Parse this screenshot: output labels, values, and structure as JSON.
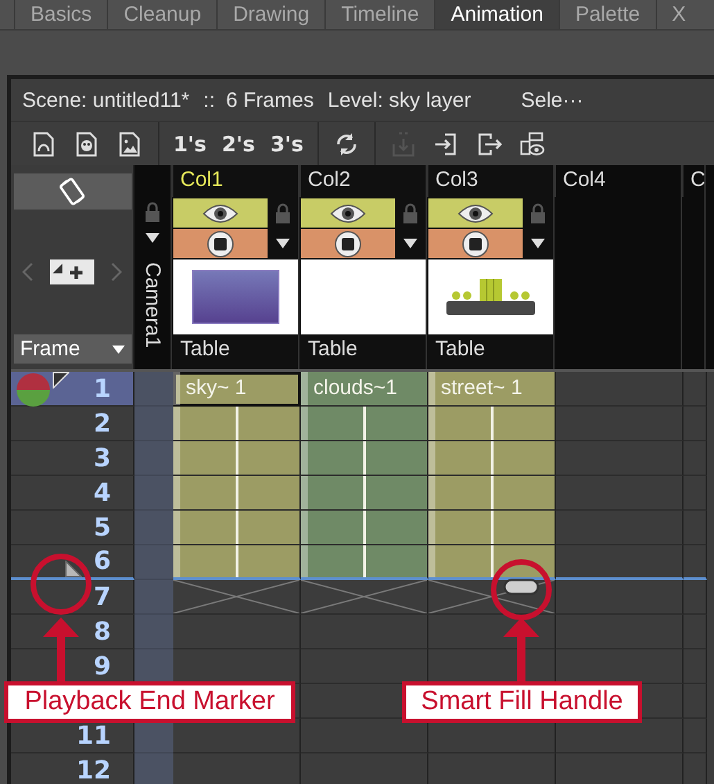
{
  "tabs": [
    {
      "label": "Basics",
      "selected": false
    },
    {
      "label": "Cleanup",
      "selected": false
    },
    {
      "label": "Drawing",
      "selected": false
    },
    {
      "label": "Timeline",
      "selected": false
    },
    {
      "label": "Animation",
      "selected": true
    },
    {
      "label": "Palette",
      "selected": false
    },
    {
      "label": "X",
      "selected": false
    }
  ],
  "scene_info": {
    "scene": "Scene: untitled11*",
    "separator": "::",
    "frames": "6 Frames",
    "level": "Level: sky layer",
    "selection": "Sele···"
  },
  "toolbar": [
    {
      "kind": "vector",
      "disabled": false
    },
    {
      "kind": "toonzraster",
      "disabled": false
    },
    {
      "kind": "raster",
      "disabled": false
    },
    {
      "kind": "step",
      "label": "1's",
      "disabled": false
    },
    {
      "kind": "step",
      "label": "2's",
      "disabled": false
    },
    {
      "kind": "step",
      "label": "3's",
      "disabled": false
    },
    {
      "kind": "cycle",
      "disabled": false
    },
    {
      "kind": "paste",
      "disabled": true
    },
    {
      "kind": "import",
      "disabled": false
    },
    {
      "kind": "export",
      "disabled": false
    },
    {
      "kind": "preview",
      "disabled": false
    }
  ],
  "frame_zoom": {
    "value": "Frame"
  },
  "camera_column": {
    "label": "Camera1",
    "locked": false
  },
  "columns": [
    {
      "name": "Col1",
      "current": true,
      "empty": false,
      "preview_visible": true,
      "camstand_visible": true,
      "locked": false,
      "thumbnail": {
        "kind": "rectangle"
      },
      "type_label": "Table",
      "color": "#9c9c64",
      "cells": [
        {
          "kind": "start",
          "text": "sky~ 1",
          "selected": true
        },
        {
          "kind": "hold",
          "selected": false
        },
        {
          "kind": "hold",
          "selected": false
        },
        {
          "kind": "hold",
          "selected": false
        },
        {
          "kind": "hold",
          "selected": false
        },
        {
          "kind": "last",
          "selected": false
        },
        {
          "kind": "end",
          "handle": false
        }
      ]
    },
    {
      "name": "Col2",
      "current": false,
      "empty": false,
      "preview_visible": true,
      "camstand_visible": true,
      "locked": false,
      "thumbnail": {
        "kind": "blank"
      },
      "type_label": "Table",
      "color": "#6f8a66",
      "cells": [
        {
          "kind": "start",
          "text": "clouds~1",
          "selected": false
        },
        {
          "kind": "hold",
          "selected": false
        },
        {
          "kind": "hold",
          "selected": false
        },
        {
          "kind": "hold",
          "selected": false
        },
        {
          "kind": "hold",
          "selected": false
        },
        {
          "kind": "last",
          "selected": false
        },
        {
          "kind": "end",
          "handle": false
        }
      ]
    },
    {
      "name": "Col3",
      "current": false,
      "empty": false,
      "preview_visible": true,
      "camstand_visible": true,
      "locked": false,
      "thumbnail": {
        "kind": "street"
      },
      "type_label": "Table",
      "color": "#9c9c64",
      "cells": [
        {
          "kind": "start",
          "text": "street~ 1",
          "selected": false
        },
        {
          "kind": "hold",
          "selected": false
        },
        {
          "kind": "hold",
          "selected": false
        },
        {
          "kind": "hold",
          "selected": false
        },
        {
          "kind": "hold",
          "selected": false
        },
        {
          "kind": "last",
          "selected": false
        },
        {
          "kind": "end",
          "handle": true
        }
      ]
    },
    {
      "name": "Col4",
      "current": false,
      "empty": true
    },
    {
      "name": "C",
      "current": false,
      "empty": true
    }
  ],
  "rows": [
    {
      "number": "1",
      "current": true,
      "onion_skin": true,
      "play_start": true,
      "play_end": false
    },
    {
      "number": "2",
      "current": false,
      "onion_skin": false,
      "play_start": false,
      "play_end": false
    },
    {
      "number": "3",
      "current": false,
      "onion_skin": false,
      "play_start": false,
      "play_end": false
    },
    {
      "number": "4",
      "current": false,
      "onion_skin": false,
      "play_start": false,
      "play_end": false
    },
    {
      "number": "5",
      "current": false,
      "onion_skin": false,
      "play_start": false,
      "play_end": false
    },
    {
      "number": "6",
      "current": false,
      "onion_skin": false,
      "play_start": false,
      "play_end": true
    },
    {
      "number": "7",
      "current": false,
      "onion_skin": false,
      "play_start": false,
      "play_end": false
    },
    {
      "number": "8",
      "current": false,
      "onion_skin": false,
      "play_start": false,
      "play_end": false
    },
    {
      "number": "9",
      "current": false,
      "onion_skin": false,
      "play_start": false,
      "play_end": false
    },
    {},
    {
      "number": "11",
      "current": false,
      "onion_skin": false,
      "play_start": false,
      "play_end": false
    },
    {
      "number": "12",
      "current": false,
      "onion_skin": false,
      "play_start": false,
      "play_end": false
    }
  ],
  "annotations": [
    {
      "kind": "marker",
      "text": "Playback End Marker"
    },
    {
      "kind": "handle",
      "text": "Smart Fill Handle"
    }
  ]
}
